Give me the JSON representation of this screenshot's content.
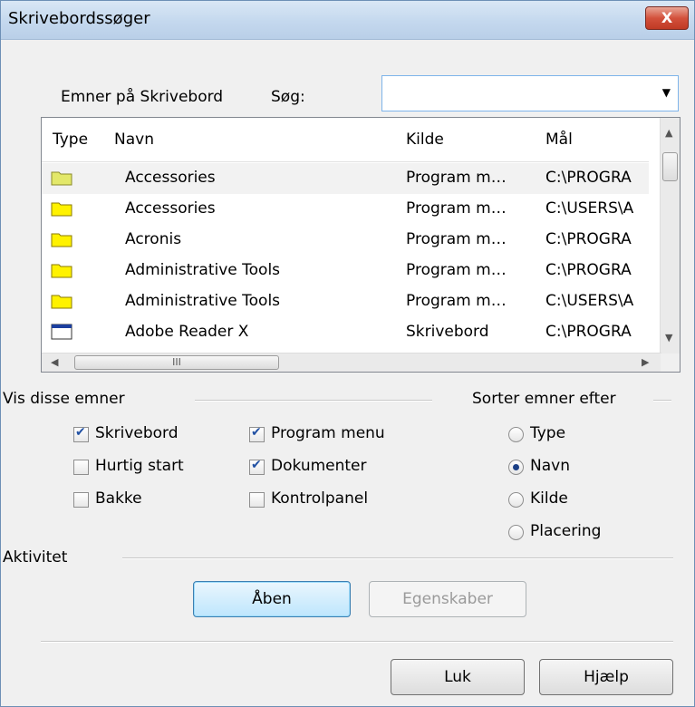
{
  "window": {
    "title": "Skrivebordssøger",
    "close_label": "X"
  },
  "items_label": "Emner på Skrivebord",
  "search": {
    "label": "Søg:",
    "value": ""
  },
  "table": {
    "columns": [
      "Type",
      "Navn",
      "Kilde",
      "Mål"
    ],
    "rows": [
      {
        "type_icon": "folder-icon",
        "name": "Accessories",
        "source": "Program m…",
        "target": "C:\\PROGRA"
      },
      {
        "type_icon": "folder-icon",
        "name": "Accessories",
        "source": "Program m…",
        "target": "C:\\USERS\\A"
      },
      {
        "type_icon": "folder-icon",
        "name": "Acronis",
        "source": "Program m…",
        "target": "C:\\PROGRA"
      },
      {
        "type_icon": "folder-icon",
        "name": "Administrative Tools",
        "source": "Program m…",
        "target": "C:\\PROGRA"
      },
      {
        "type_icon": "folder-icon",
        "name": "Administrative Tools",
        "source": "Program m…",
        "target": "C:\\USERS\\A"
      },
      {
        "type_icon": "application-icon",
        "name": "Adobe Reader X",
        "source": "Skrivebord",
        "target": "C:\\PROGRA"
      }
    ],
    "hscroll_grip": "III"
  },
  "show_items": {
    "title": "Vis disse emner",
    "options": [
      {
        "label": "Skrivebord",
        "checked": true
      },
      {
        "label": "Hurtig start",
        "checked": false
      },
      {
        "label": "Bakke",
        "checked": false
      },
      {
        "label": "Program menu",
        "checked": true
      },
      {
        "label": "Dokumenter",
        "checked": true
      },
      {
        "label": "Kontrolpanel",
        "checked": false
      }
    ]
  },
  "sort": {
    "title": "Sorter emner efter",
    "options": [
      {
        "label": "Type",
        "selected": false
      },
      {
        "label": "Navn",
        "selected": true
      },
      {
        "label": "Kilde",
        "selected": false
      },
      {
        "label": "Placering",
        "selected": false
      }
    ]
  },
  "activity": {
    "title": "Aktivitet",
    "open_label": "Åben",
    "properties_label": "Egenskaber"
  },
  "footer": {
    "close_label": "Luk",
    "help_label": "Hjælp"
  }
}
